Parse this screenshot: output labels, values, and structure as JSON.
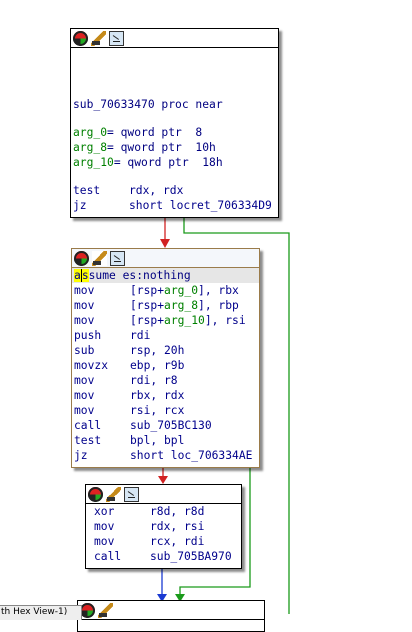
{
  "view_title_partial": "th Hex View-1)",
  "block1": {
    "proc_line": "sub_70633470 proc near",
    "args": [
      {
        "name": "arg_0",
        "suffix": "= qword ptr  8"
      },
      {
        "name": "arg_8",
        "suffix": "= qword ptr  10h"
      },
      {
        "name": "arg_10",
        "suffix": "= qword ptr  18h"
      }
    ],
    "instructions": [
      {
        "mnemonic": "test",
        "operands": "rdx, rdx"
      },
      {
        "mnemonic": "jz",
        "operands": "short locret_706334D9"
      }
    ]
  },
  "block2": {
    "assume_a": "a",
    "assume_cursor": "s",
    "assume_rest": "sume es:nothing",
    "instructions": [
      {
        "mnemonic": "mov",
        "pre": "[rsp+",
        "arg": "arg_0",
        "post": "], rbx"
      },
      {
        "mnemonic": "mov",
        "pre": "[rsp+",
        "arg": "arg_8",
        "post": "], rbp"
      },
      {
        "mnemonic": "mov",
        "pre": "[rsp+",
        "arg": "arg_10",
        "post": "], rsi"
      },
      {
        "mnemonic": "push",
        "pre": "rdi",
        "arg": "",
        "post": ""
      },
      {
        "mnemonic": "sub",
        "pre": "rsp, 20h",
        "arg": "",
        "post": ""
      },
      {
        "mnemonic": "movzx",
        "pre": "ebp, r9b",
        "arg": "",
        "post": ""
      },
      {
        "mnemonic": "mov",
        "pre": "rdi, r8",
        "arg": "",
        "post": ""
      },
      {
        "mnemonic": "mov",
        "pre": "rbx, rdx",
        "arg": "",
        "post": ""
      },
      {
        "mnemonic": "mov",
        "pre": "rsi, rcx",
        "arg": "",
        "post": ""
      },
      {
        "mnemonic": "call",
        "pre": "sub_705BC130",
        "arg": "",
        "post": ""
      },
      {
        "mnemonic": "test",
        "pre": "bpl, bpl",
        "arg": "",
        "post": ""
      },
      {
        "mnemonic": "jz",
        "pre": "short loc_706334AE",
        "arg": "",
        "post": ""
      }
    ]
  },
  "block3": {
    "instructions": [
      {
        "mnemonic": "xor",
        "operands": "r8d, r8d"
      },
      {
        "mnemonic": "mov",
        "operands": "rdx, rsi"
      },
      {
        "mnemonic": "mov",
        "operands": "rcx, rdi"
      },
      {
        "mnemonic": "call",
        "operands": "sub_705BA970"
      }
    ]
  },
  "colors": {
    "edge_false": "#d22222",
    "edge_true": "#1a9a1a",
    "edge_uncond": "#1a3ad2",
    "mnemonic": "#00008b",
    "arg": "#008000"
  }
}
